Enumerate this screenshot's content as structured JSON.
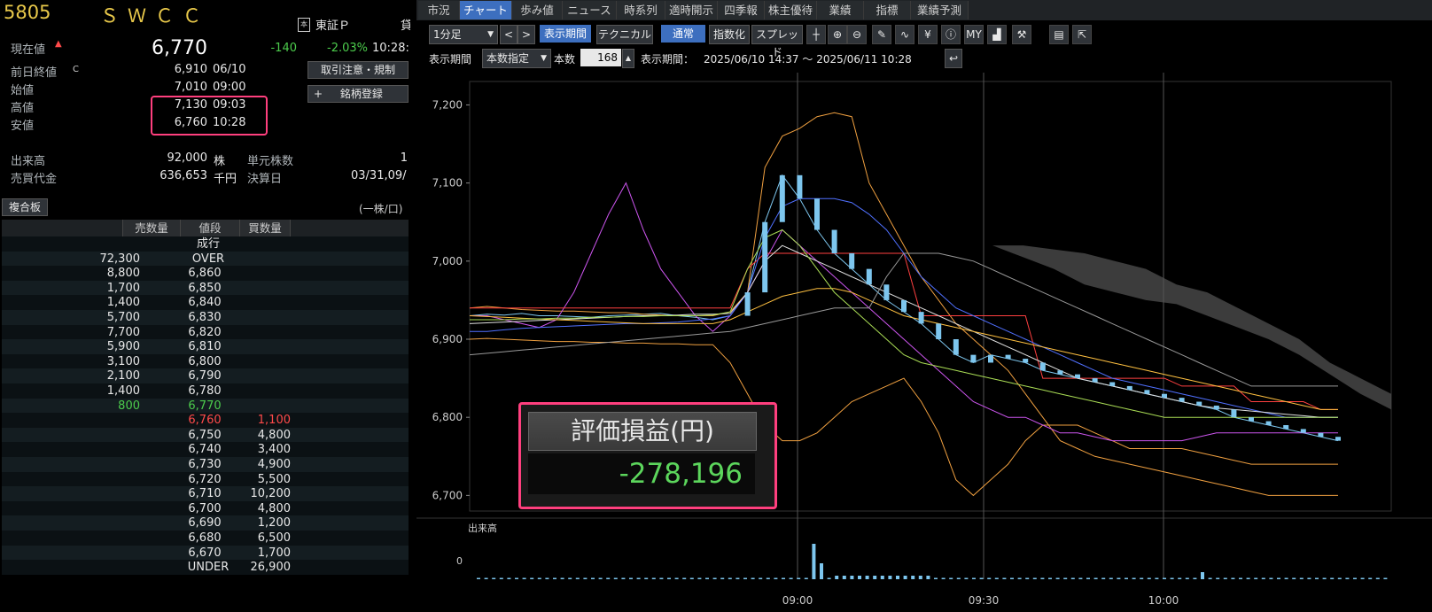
{
  "header": {
    "code": "5805",
    "name": "ＳＷＣＣ",
    "market_icon": "本",
    "market": "東証Ｐ",
    "market_cut": "貸"
  },
  "quote": {
    "current_label": "現在値",
    "current_arrow": "▲",
    "current_value": "6,770",
    "change": "-140",
    "change_pct": "-2.03%",
    "current_time": "10:28:",
    "prev_label": "前日終値",
    "prev_flag": "C",
    "prev_value": "6,910",
    "prev_date": "06/10",
    "open_label": "始値",
    "open_value": "7,010",
    "open_time": "09:00",
    "high_label": "高値",
    "high_value": "7,130",
    "high_time": "09:03",
    "low_label": "安値",
    "low_value": "6,760",
    "low_time": "10:28",
    "volume_label": "出来高",
    "volume_value": "92,000",
    "volume_unit": "株",
    "unit_label": "単元株数",
    "unit_value": "1",
    "turnover_label": "売買代金",
    "turnover_value": "636,653",
    "turnover_unit": "千円",
    "settle_label": "決算日",
    "settle_value": "03/31,09/"
  },
  "buttons": {
    "notice": "取引注意・規制",
    "add_plus": "+",
    "add": "銘柄登録"
  },
  "orderbook": {
    "tab": "複合板",
    "unit": "(一株/口)",
    "col_sell": "売数量",
    "col_price": "値段",
    "col_buy": "買数量",
    "rows": [
      {
        "s": "",
        "p": "成行",
        "b": ""
      },
      {
        "s": "72,300",
        "p": "OVER",
        "b": ""
      },
      {
        "s": "8,800",
        "p": "6,860",
        "b": ""
      },
      {
        "s": "1,700",
        "p": "6,850",
        "b": ""
      },
      {
        "s": "1,400",
        "p": "6,840",
        "b": ""
      },
      {
        "s": "5,700",
        "p": "6,830",
        "b": ""
      },
      {
        "s": "7,700",
        "p": "6,820",
        "b": ""
      },
      {
        "s": "5,900",
        "p": "6,810",
        "b": ""
      },
      {
        "s": "3,100",
        "p": "6,800",
        "b": ""
      },
      {
        "s": "2,100",
        "p": "6,790",
        "b": ""
      },
      {
        "s": "1,400",
        "p": "6,780",
        "b": ""
      },
      {
        "s": "800",
        "p": "6,770",
        "b": ""
      },
      {
        "s": "",
        "p": "6,760",
        "b": "1,100"
      },
      {
        "s": "",
        "p": "6,750",
        "b": "4,800"
      },
      {
        "s": "",
        "p": "6,740",
        "b": "3,400"
      },
      {
        "s": "",
        "p": "6,730",
        "b": "4,900"
      },
      {
        "s": "",
        "p": "6,720",
        "b": "5,500"
      },
      {
        "s": "",
        "p": "6,710",
        "b": "10,200"
      },
      {
        "s": "",
        "p": "6,700",
        "b": "4,800"
      },
      {
        "s": "",
        "p": "6,690",
        "b": "1,200"
      },
      {
        "s": "",
        "p": "6,680",
        "b": "6,500"
      },
      {
        "s": "",
        "p": "6,670",
        "b": "1,700"
      },
      {
        "s": "",
        "p": "UNDER",
        "b": "26,900"
      }
    ]
  },
  "tabs": [
    "市況",
    "チャート",
    "歩み値",
    "ニュース",
    "時系列",
    "適時開示",
    "四季報",
    "株主優待",
    "業績",
    "指標",
    "業績予測"
  ],
  "active_tab": "チャート",
  "toolbar": {
    "interval": "1分足",
    "prev": "<",
    "next": ">",
    "period_btn": "表示期間",
    "technical": "テクニカル",
    "normal": "通常",
    "index": "指数化",
    "spread": "スプレッド",
    "icons": [
      "crosshair-icon",
      "zoom-in-icon",
      "zoom-out-icon",
      "pen-icon",
      "wave-icon",
      "yen-icon",
      "info-icon",
      "my-icon",
      "volume-icon",
      "wrench-icon",
      "print-icon",
      "export-icon"
    ],
    "icon_glyphs": [
      "┼",
      "⊕",
      "⊖",
      "✎",
      "∿",
      "¥",
      "ⓘ",
      "MY",
      "▟",
      "⚒",
      "▤",
      "⇱"
    ],
    "period_label": "表示期間",
    "period_mode": "本数指定",
    "count_label": "本数",
    "count": "168",
    "range_label": "表示期間：",
    "range": "2025/06/10 14:37 〜 2025/06/11 10:28",
    "reset": "↩"
  },
  "colors": {
    "up": "#ff4a4a",
    "down": "#4ccc4c",
    "highlight": "#ff3f7e",
    "candle": "#7dc6ee",
    "accent": "#3d6fbf"
  },
  "chart_data": {
    "type": "line",
    "ylabel": "",
    "xlabel": "",
    "ylim": [
      6680,
      7230
    ],
    "yticks": [
      "7,200",
      "7,100",
      "7,000",
      "6,900",
      "6,800",
      "6,700"
    ],
    "xticks": [
      "09:00",
      "09:30",
      "10:00"
    ],
    "volume_label": "出来高",
    "volume_ticks": [
      "0"
    ],
    "series": [
      {
        "color": "#7dc6ee",
        "values": [
          6930,
          6932,
          6931,
          6933,
          6930,
          6930,
          6929,
          6928,
          6930,
          6931,
          6932,
          6933,
          6930,
          6928,
          6925,
          6930,
          6960,
          7050,
          7110,
          7080,
          7040,
          7010,
          6990,
          6970,
          6950,
          6935,
          6920,
          6900,
          6880,
          6870,
          6880,
          6875,
          6870,
          6860,
          6855,
          6850,
          6845,
          6840,
          6835,
          6830,
          6825,
          6820,
          6815,
          6810,
          6800,
          6795,
          6790,
          6785,
          6780,
          6775,
          6770
        ]
      },
      {
        "color": "#f0a040",
        "values": [
          6940,
          6942,
          6940,
          6938,
          6937,
          6936,
          6936,
          6935,
          6934,
          6934,
          6932,
          6931,
          6930,
          6930,
          6930,
          6935,
          6960,
          7120,
          7160,
          7170,
          7185,
          7190,
          7185,
          7100,
          7060,
          7020,
          6980,
          6950,
          6920,
          6900,
          6880,
          6860,
          6830,
          6800,
          6770,
          6760,
          6750,
          6745,
          6740,
          6735,
          6730,
          6725,
          6720,
          6715,
          6710,
          6705,
          6700,
          6700,
          6700,
          6700,
          6700
        ]
      },
      {
        "color": "#f0a040",
        "values": [
          6900,
          6901,
          6900,
          6899,
          6898,
          6897,
          6897,
          6896,
          6896,
          6895,
          6895,
          6894,
          6894,
          6893,
          6893,
          6870,
          6830,
          6790,
          6770,
          6770,
          6780,
          6800,
          6820,
          6830,
          6840,
          6850,
          6820,
          6780,
          6720,
          6700,
          6720,
          6740,
          6770,
          6790,
          6790,
          6790,
          6780,
          6770,
          6760,
          6760,
          6760,
          6760,
          6755,
          6750,
          6745,
          6740,
          6740,
          6740,
          6740,
          6740,
          6740
        ]
      },
      {
        "color": "#cc55ee",
        "values": [
          6930,
          6930,
          6925,
          6920,
          6915,
          6925,
          6960,
          7010,
          7060,
          7100,
          7040,
          6990,
          6960,
          6930,
          6910,
          6930,
          6960,
          7000,
          7040,
          7020,
          7000,
          6980,
          6960,
          6940,
          6920,
          6900,
          6880,
          6860,
          6840,
          6820,
          6810,
          6800,
          6800,
          6790,
          6780,
          6780,
          6775,
          6770,
          6770,
          6770,
          6770,
          6770,
          6775,
          6780,
          6780,
          6780,
          6780,
          6780,
          6780,
          6780,
          6780
        ]
      },
      {
        "color": "#ff4040",
        "values": [
          6940,
          6940,
          6940,
          6940,
          6940,
          6940,
          6940,
          6940,
          6940,
          6940,
          6940,
          6940,
          6940,
          6940,
          6940,
          6940,
          6990,
          7010,
          7010,
          7010,
          7010,
          7010,
          7010,
          7010,
          7010,
          7010,
          6930,
          6930,
          6930,
          6930,
          6930,
          6930,
          6930,
          6850,
          6850,
          6850,
          6850,
          6850,
          6850,
          6850,
          6850,
          6840,
          6840,
          6840,
          6840,
          6820,
          6820,
          6820,
          6820,
          6810,
          6810
        ]
      },
      {
        "color": "#5070ff",
        "values": [
          6910,
          6910,
          6912,
          6914,
          6915,
          6916,
          6917,
          6918,
          6919,
          6920,
          6920,
          6921,
          6922,
          6924,
          6926,
          6930,
          6960,
          7030,
          7070,
          7080,
          7080,
          7080,
          7075,
          7060,
          7040,
          7010,
          6980,
          6960,
          6940,
          6930,
          6920,
          6910,
          6900,
          6890,
          6880,
          6870,
          6860,
          6850,
          6845,
          6840,
          6835,
          6830,
          6825,
          6820,
          6815,
          6810,
          6805,
          6800,
          6800,
          6800,
          6800
        ]
      },
      {
        "color": "#e0e0e0",
        "values": [
          6920,
          6921,
          6922,
          6923,
          6924,
          6925,
          6926,
          6927,
          6928,
          6929,
          6930,
          6930,
          6931,
          6932,
          6932,
          6933,
          6960,
          7000,
          7020,
          7010,
          7000,
          6990,
          6980,
          6970,
          6960,
          6950,
          6940,
          6930,
          6920,
          6910,
          6900,
          6890,
          6880,
          6870,
          6860,
          6850,
          6845,
          6840,
          6835,
          6830,
          6825,
          6820,
          6815,
          6812,
          6810,
          6808,
          6806,
          6804,
          6802,
          6800,
          6800
        ]
      },
      {
        "color": "#ffc040",
        "values": [
          6930,
          6929,
          6928,
          6927,
          6926,
          6925,
          6924,
          6923,
          6922,
          6921,
          6920,
          6920,
          6920,
          6920,
          6920,
          6925,
          6935,
          6945,
          6955,
          6960,
          6965,
          6965,
          6960,
          6950,
          6940,
          6930,
          6925,
          6920,
          6915,
          6910,
          6905,
          6900,
          6895,
          6890,
          6885,
          6880,
          6875,
          6870,
          6865,
          6860,
          6855,
          6850,
          6845,
          6840,
          6835,
          6830,
          6825,
          6820,
          6815,
          6810,
          6810
        ]
      },
      {
        "color": "#aadd55",
        "values": [
          6925,
          6925,
          6925,
          6926,
          6926,
          6927,
          6927,
          6928,
          6928,
          6929,
          6929,
          6930,
          6930,
          6930,
          6931,
          6935,
          6990,
          7030,
          7040,
          7020,
          6990,
          6960,
          6940,
          6920,
          6900,
          6880,
          6870,
          6865,
          6860,
          6855,
          6850,
          6845,
          6840,
          6835,
          6830,
          6825,
          6820,
          6815,
          6810,
          6805,
          6800,
          6800,
          6800,
          6800,
          6800,
          6800,
          6800,
          6800,
          6800,
          6800,
          6800
        ]
      },
      {
        "color": "#999999",
        "values": [
          6880,
          6882,
          6884,
          6886,
          6888,
          6890,
          6892,
          6894,
          6896,
          6898,
          6900,
          6902,
          6904,
          6906,
          6908,
          6910,
          6915,
          6920,
          6925,
          6930,
          6935,
          6940,
          6940,
          6940,
          6980,
          7010,
          7010,
          7010,
          7005,
          7000,
          6990,
          6980,
          6970,
          6960,
          6950,
          6940,
          6930,
          6920,
          6910,
          6900,
          6890,
          6880,
          6870,
          6860,
          6850,
          6840,
          6840,
          6840,
          6840,
          6840,
          6840
        ]
      }
    ]
  }
}
